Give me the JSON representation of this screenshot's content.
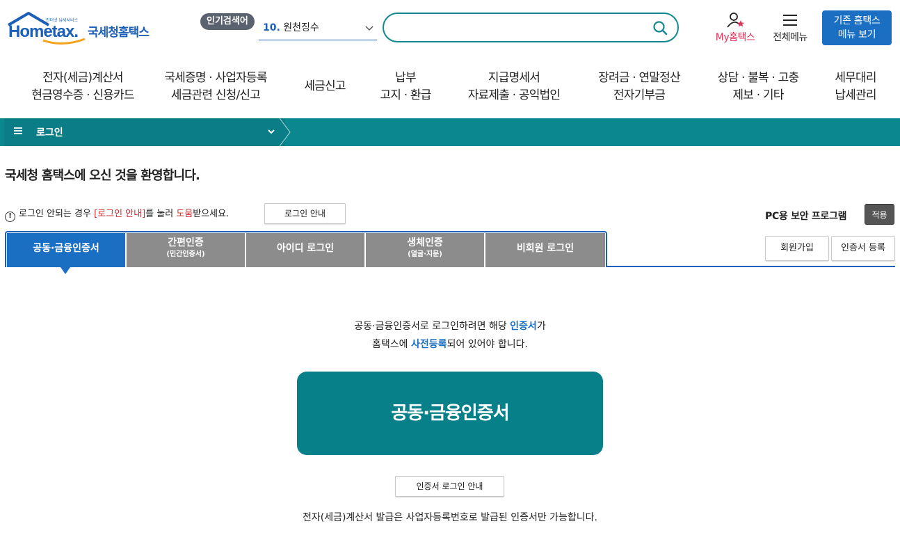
{
  "header": {
    "logo_small": "인터넷 납세서비스",
    "logo_home": "Hometax.",
    "logo_kor": "국세청홈택스",
    "popular_badge": "인기검색어",
    "popular_num": "10.",
    "popular_text": "원천징수",
    "search_placeholder": "",
    "myhometax": "My홈택스",
    "allmenu": "전체메뉴",
    "legacy_line1": "기존 홈택스",
    "legacy_line2": "메뉴 보기"
  },
  "nav": [
    {
      "line1": "전자(세금)계산서",
      "line2": "현금영수증 · 신용카드"
    },
    {
      "line1": "국세증명 · 사업자등록",
      "line2": "세금관련 신청/신고"
    },
    {
      "line1": "세금신고",
      "line2": ""
    },
    {
      "line1": "납부",
      "line2": "고지 · 환급"
    },
    {
      "line1": "지급명세서",
      "line2": "자료제출 · 공익법인"
    },
    {
      "line1": "장려금 · 연말정산",
      "line2": "전자기부금"
    },
    {
      "line1": "상담 · 불복 · 고충",
      "line2": "제보 · 기타"
    },
    {
      "line1": "세무대리",
      "line2": "납세관리"
    }
  ],
  "breadcrumb": {
    "label": "로그인"
  },
  "welcome": "국세청 홈택스에 오신 것을 환영합니다.",
  "help": {
    "pre": "로그인 안되는 경우 ",
    "link": "[로그인 안내]",
    "mid": "를 눌러 ",
    "help_word": "도움",
    "post": "받으세요.",
    "button": "로그인 안내"
  },
  "security": {
    "label": "PC용 보안 프로그램",
    "apply": "적용"
  },
  "tabs": [
    {
      "label": "공동·금융인증서",
      "sub": ""
    },
    {
      "label": "간편인증",
      "sub": "(민간인증서)"
    },
    {
      "label": "아이디 로그인",
      "sub": ""
    },
    {
      "label": "생체인증",
      "sub": "(얼굴·지문)"
    },
    {
      "label": "비회원 로그인",
      "sub": ""
    }
  ],
  "side_buttons": {
    "join": "회원가입",
    "cert_register": "인증서 등록"
  },
  "intro": {
    "l1_pre": "공동·금융인증서로 로그인하려면 해당 ",
    "l1_blue": "인증서",
    "l1_post": "가",
    "l2_pre": "홈택스에 ",
    "l2_blue": "사전등록",
    "l2_post": "되어 있어야 합니다."
  },
  "cert_button": "공동·금융인증서",
  "cert_guide_button": "인증서 로그인 안내",
  "footer_note": "전자(세금)계산서 발급은 사업자등록번호로 발급된 인증서만 가능합니다.",
  "colors": {
    "teal": "#0b8790",
    "blue": "#1a6fc3",
    "red": "#d12a2a",
    "pink": "#e0335a"
  }
}
